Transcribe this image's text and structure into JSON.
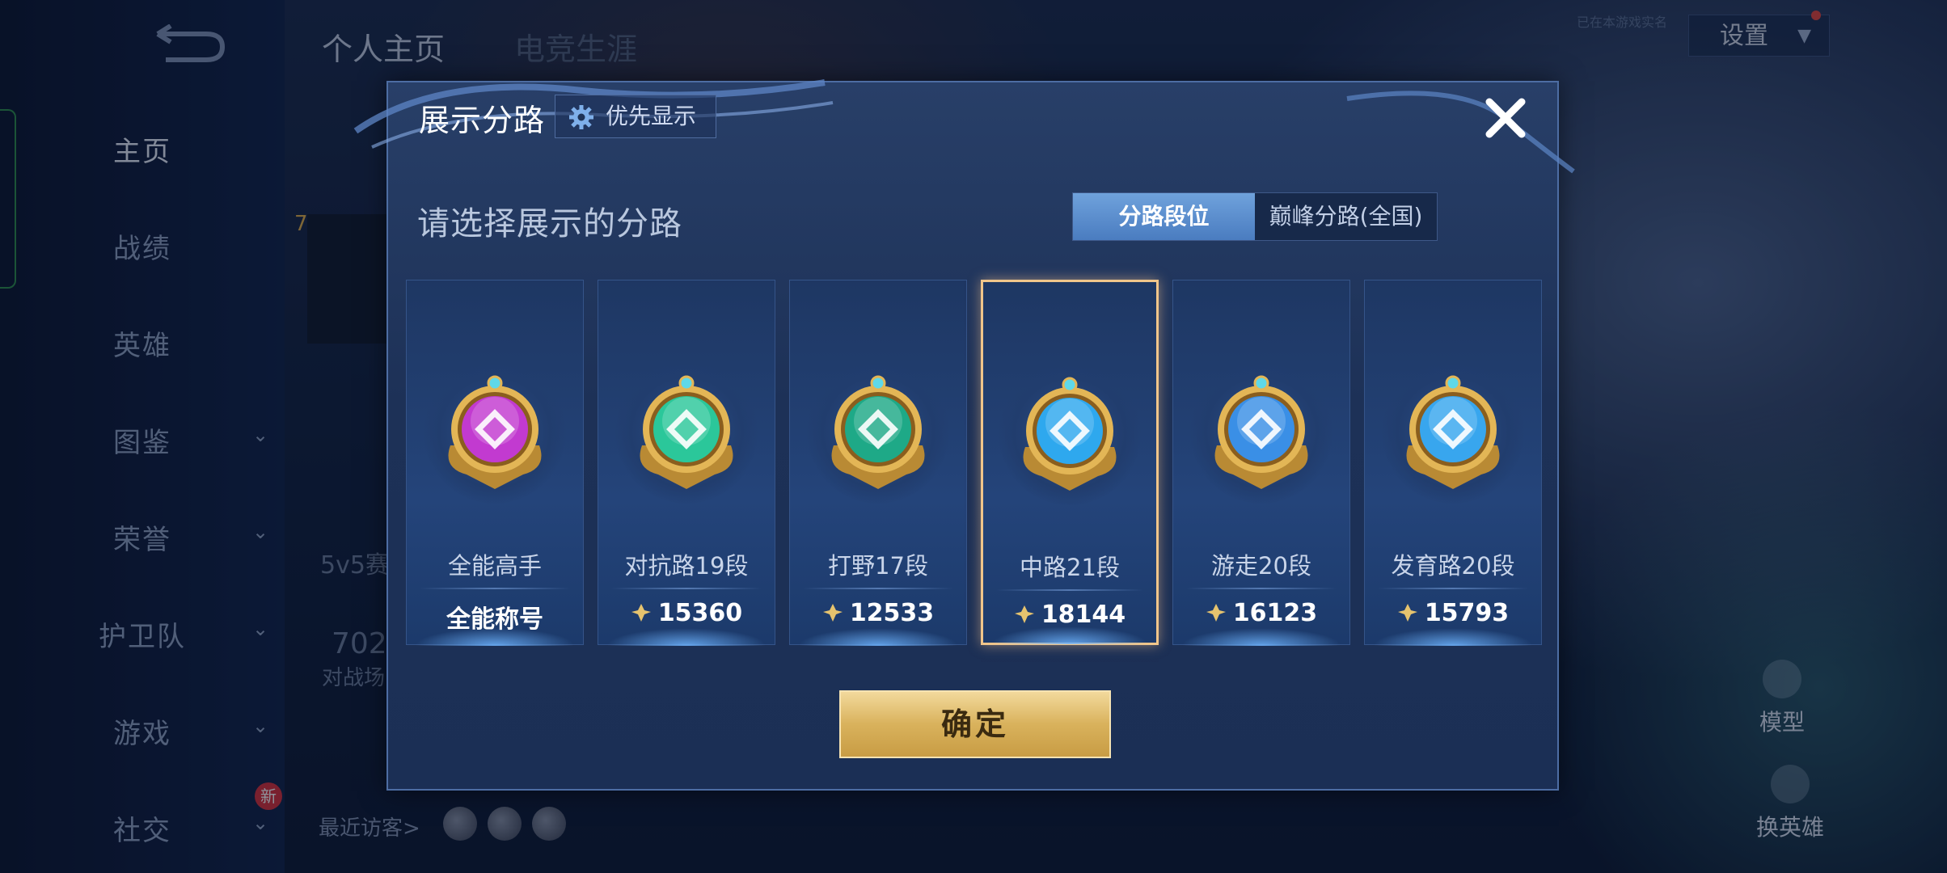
{
  "nav": {
    "items": [
      {
        "label": "主页",
        "active": true,
        "chevron": false
      },
      {
        "label": "战绩",
        "active": false,
        "chevron": false
      },
      {
        "label": "英雄",
        "active": false,
        "chevron": false
      },
      {
        "label": "图鉴",
        "active": false,
        "chevron": true
      },
      {
        "label": "荣誉",
        "active": false,
        "chevron": true
      },
      {
        "label": "护卫队",
        "active": false,
        "chevron": true
      },
      {
        "label": "游戏",
        "active": false,
        "chevron": true
      },
      {
        "label": "社交",
        "active": false,
        "chevron": true
      }
    ],
    "new_badge": "新"
  },
  "top_tabs": [
    "个人主页",
    "电竞生涯"
  ],
  "settings_label": "设置",
  "top_small_text": "已在本游戏实名",
  "behind": {
    "level": "7",
    "mode_text": "5v5赛",
    "score_text": "702",
    "match_text": "对战场",
    "recent_visitors": "最近访客>",
    "model_label": "模型",
    "switch_hero_label": "换英雄"
  },
  "modal": {
    "title": "展示分路",
    "priority_label": "优先显示",
    "subtitle": "请选择展示的分路",
    "segments": [
      "分路段位",
      "巅峰分路(全国)"
    ],
    "active_segment": 0,
    "confirm_label": "确定",
    "cards": [
      {
        "label": "全能高手",
        "value": "全能称号",
        "has_points": false,
        "selected": false,
        "badge_icon": "all-round-badge-icon",
        "gem": "#c23ad0"
      },
      {
        "label": "对抗路19段",
        "value": "15360",
        "has_points": true,
        "selected": false,
        "badge_icon": "clash-lane-badge-icon",
        "gem": "#2bc79a"
      },
      {
        "label": "打野17段",
        "value": "12533",
        "has_points": true,
        "selected": false,
        "badge_icon": "jungle-badge-icon",
        "gem": "#1ea987"
      },
      {
        "label": "中路21段",
        "value": "18144",
        "has_points": true,
        "selected": true,
        "badge_icon": "mid-lane-badge-icon",
        "gem": "#2ea8ee"
      },
      {
        "label": "游走20段",
        "value": "16123",
        "has_points": true,
        "selected": false,
        "badge_icon": "roam-badge-icon",
        "gem": "#3a8fe6"
      },
      {
        "label": "发育路20段",
        "value": "15793",
        "has_points": true,
        "selected": false,
        "badge_icon": "farm-lane-badge-icon",
        "gem": "#38a6ee"
      }
    ]
  },
  "colors": {
    "accent": "#4a7cc0",
    "selected_border": "#f0c58a",
    "confirm_gold": "#d9b25c"
  }
}
